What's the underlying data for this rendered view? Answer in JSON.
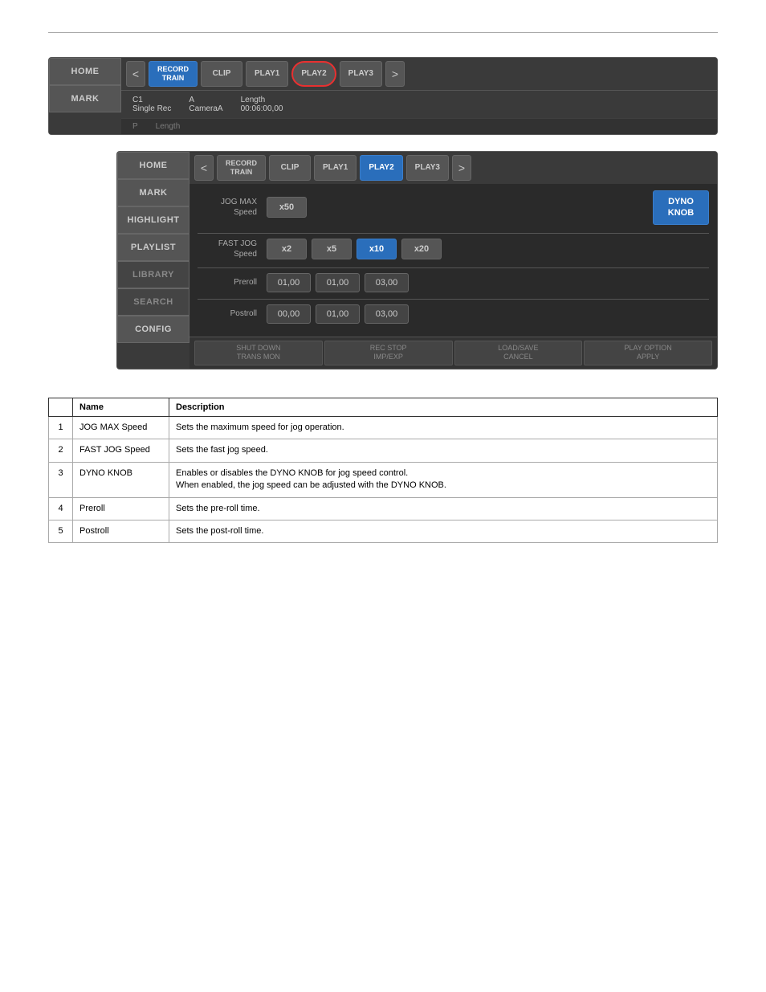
{
  "page": {
    "top_rule": true
  },
  "panel1": {
    "sidebar": {
      "home_label": "HOME",
      "mark_label": "MARK"
    },
    "tabs": {
      "nav_left": "<",
      "nav_right": ">",
      "items": [
        {
          "id": "record_train",
          "label": "RECORD\nTRAIN",
          "active": false
        },
        {
          "id": "clip",
          "label": "CLIP",
          "active": false
        },
        {
          "id": "play1",
          "label": "PLAY1",
          "active": false
        },
        {
          "id": "play2",
          "label": "PLAY2",
          "active": false,
          "highlighted": true
        },
        {
          "id": "play3",
          "label": "PLAY3",
          "active": false
        }
      ]
    },
    "info_bar": {
      "channel": "C1",
      "mode": "Single Rec",
      "camera_label": "A",
      "camera_name": "CameraA",
      "length_label": "Length",
      "length_value": "00:06:00,00",
      "row2_left": "P",
      "row2_right": "Length"
    }
  },
  "panel2": {
    "sidebar": {
      "items": [
        {
          "label": "HOME"
        },
        {
          "label": "MARK"
        },
        {
          "label": "HIGHLIGHT"
        },
        {
          "label": "PLAYLIST"
        },
        {
          "label": "LIBRARY",
          "disabled": true
        },
        {
          "label": "SEARCH",
          "disabled": true
        },
        {
          "label": "CONFIG"
        }
      ]
    },
    "tabs": {
      "nav_left": "<",
      "nav_right": ">",
      "items": [
        {
          "id": "record_train",
          "label": "RECORD\nTRAIN",
          "active": false
        },
        {
          "id": "clip",
          "label": "CLIP",
          "active": false
        },
        {
          "id": "play1",
          "label": "PLAY1",
          "active": false
        },
        {
          "id": "play2",
          "label": "PLAY2",
          "active": true
        },
        {
          "id": "play3",
          "label": "PLAY3",
          "active": false
        }
      ]
    },
    "jog_max": {
      "label": "JOG MAX\nSpeed",
      "buttons": [
        {
          "label": "x50",
          "active": false
        }
      ],
      "dyno_label": "DYNO\nKNOB"
    },
    "fast_jog": {
      "label": "FAST JOG\nSpeed",
      "buttons": [
        {
          "label": "x2",
          "active": false
        },
        {
          "label": "x5",
          "active": false
        },
        {
          "label": "x10",
          "active": true
        },
        {
          "label": "x20",
          "active": false
        }
      ]
    },
    "preroll": {
      "label": "Preroll",
      "values": [
        "01,00",
        "01,00",
        "03,00"
      ]
    },
    "postroll": {
      "label": "Postroll",
      "values": [
        "00,00",
        "01,00",
        "03,00"
      ]
    },
    "actions": [
      {
        "label": "SHUT DOWN\nTRANS MON"
      },
      {
        "label": "REC STOP\nIMP/EXP"
      },
      {
        "label": "LOAD/SAVE\nCANCEL"
      },
      {
        "label": "PLAY OPTION\nAPPLY"
      }
    ]
  },
  "annotations": {
    "jog_max_label": "JOG MAX Speed",
    "fast_jog_label": "FAST JOG Speed",
    "preroll_label": "Preroll",
    "postroll_label": "Postroll",
    "dyno_label": "DYNO KNOB"
  },
  "table": {
    "headers": [
      "",
      "Name",
      "Description"
    ],
    "rows": [
      {
        "num": "1",
        "name": "JOG MAX Speed",
        "desc": "Sets the maximum speed for jog operation."
      },
      {
        "num": "2",
        "name": "FAST JOG Speed",
        "desc": "Sets the fast jog speed."
      },
      {
        "num": "3",
        "name": "DYNO KNOB",
        "desc": "Enables or disables the DYNO KNOB for jog speed control.\nWhen enabled, the jog speed can be adjusted with the DYNO KNOB."
      },
      {
        "num": "4",
        "name": "Preroll",
        "desc": "Sets the pre-roll time."
      },
      {
        "num": "5",
        "name": "Postroll",
        "desc": "Sets the post-roll time."
      }
    ]
  }
}
